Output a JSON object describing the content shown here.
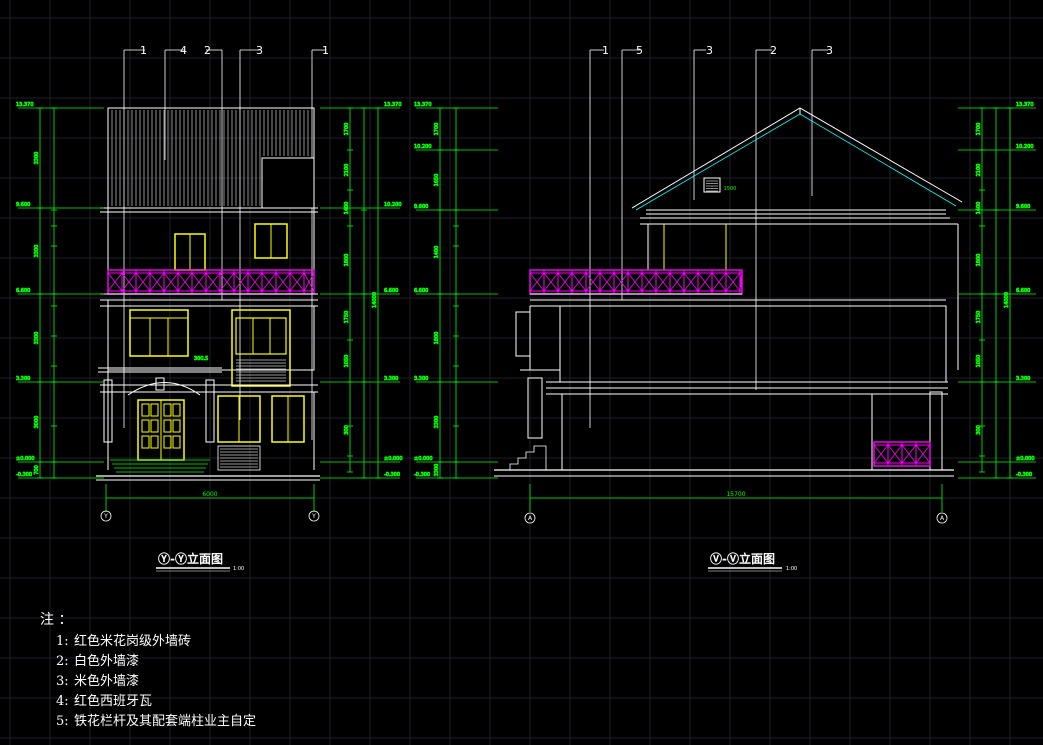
{
  "colors": {
    "background": "#000000",
    "grid": "#1e1e2a",
    "dimension": "#00ff00",
    "outline": "#ffffff",
    "window": "#ffff00",
    "railing": "#ff00ff",
    "roof_edge": "#00ffff",
    "level_tag": "#00ff00"
  },
  "left_elevation": {
    "title": "Ⓨ-Ⓨ立面图",
    "scale": "1:00",
    "width_dim": "6000",
    "axis_left": "Y",
    "axis_right": "Y",
    "callouts": [
      "1",
      "4",
      "2",
      "3",
      "1"
    ],
    "levels_left": [
      "13.370",
      "9.600",
      "6.600",
      "3.300",
      "±0.000",
      "-0.300"
    ],
    "levels_right": [
      "13.370",
      "10.200",
      "6.600",
      "3.300",
      "±0.000",
      "-0.300"
    ],
    "dims_left": [
      "3300",
      "3300",
      "3300",
      "3000",
      "700",
      "300"
    ],
    "dims_right": [
      "1700",
      "2100",
      "1400",
      "1800",
      "1750",
      "1050",
      "300"
    ],
    "total_right": "14000",
    "small_label": "300.5"
  },
  "right_elevation": {
    "title": "Ⓥ-Ⓥ立面图",
    "scale": "1:00",
    "width_dim": "15700",
    "axis_left": "A",
    "axis_right": "A",
    "callouts": [
      "1",
      "5",
      "3",
      "2",
      "3"
    ],
    "levels_left": [
      "13.370",
      "10.200",
      "9.600",
      "6.600",
      "3.300",
      "±0.000",
      "-0.300"
    ],
    "levels_right": [
      "13.370",
      "10.200",
      "9.600",
      "6.600",
      "3.300",
      "±0.000",
      "-0.300"
    ],
    "dims_left": [
      "1700",
      "1650",
      "1400",
      "1800",
      "3300",
      "3300",
      "300"
    ],
    "dims_right": [
      "1700",
      "2100",
      "1400",
      "1800",
      "1750",
      "1050",
      "300"
    ],
    "total_right": "14000",
    "vent_label": "1500"
  },
  "notes": {
    "heading": "注 ：",
    "items": [
      {
        "num": "1:",
        "text": "红色米花岗级外墙砖"
      },
      {
        "num": "2:",
        "text": "白色外墙漆"
      },
      {
        "num": "3:",
        "text": "米色外墙漆"
      },
      {
        "num": "4:",
        "text": "红色西班牙瓦"
      },
      {
        "num": "5:",
        "text": "铁花栏杆及其配套端柱业主自定"
      }
    ]
  }
}
